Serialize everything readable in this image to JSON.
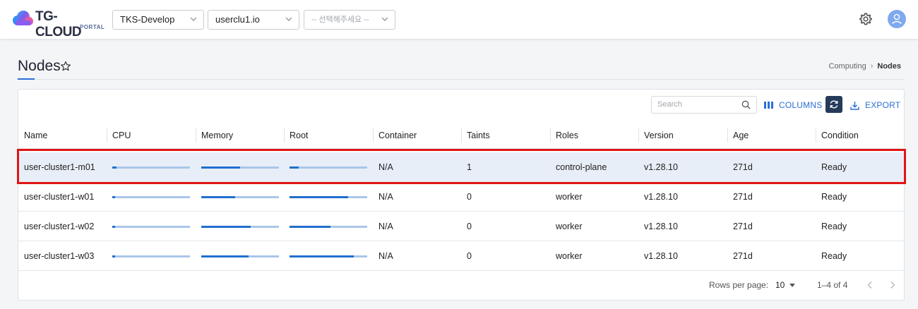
{
  "app": {
    "logo_text": "TG-CLOUD",
    "logo_subtext": "PORTAL"
  },
  "header": {
    "project_select": "TKS-Develop",
    "cluster_select": "userclu1.io",
    "namespace_placeholder": "-- 선택해주세요 --"
  },
  "page": {
    "title": "Nodes",
    "breadcrumb": [
      "Computing",
      "Nodes"
    ]
  },
  "toolbar": {
    "search_placeholder": "Search",
    "columns_label": "COLUMNS",
    "export_label": "EXPORT"
  },
  "table": {
    "columns": [
      "Name",
      "CPU",
      "Memory",
      "Root",
      "Container",
      "Taints",
      "Roles",
      "Version",
      "Age",
      "Condition"
    ],
    "rows": [
      {
        "name": "user-cluster1-m01",
        "cpu": 0.05,
        "memory": 0.5,
        "root": 0.12,
        "container": "N/A",
        "taints": "1",
        "roles": "control-plane",
        "version": "v1.28.10",
        "age": "271d",
        "condition": "Ready"
      },
      {
        "name": "user-cluster1-w01",
        "cpu": 0.04,
        "memory": 0.44,
        "root": 0.75,
        "container": "N/A",
        "taints": "0",
        "roles": "worker",
        "version": "v1.28.10",
        "age": "271d",
        "condition": "Ready"
      },
      {
        "name": "user-cluster1-w02",
        "cpu": 0.04,
        "memory": 0.64,
        "root": 0.53,
        "container": "N/A",
        "taints": "0",
        "roles": "worker",
        "version": "v1.28.10",
        "age": "271d",
        "condition": "Ready"
      },
      {
        "name": "user-cluster1-w03",
        "cpu": 0.04,
        "memory": 0.61,
        "root": 0.83,
        "container": "N/A",
        "taints": "0",
        "roles": "worker",
        "version": "v1.28.10",
        "age": "271d",
        "condition": "Ready"
      }
    ]
  },
  "pagination": {
    "rows_per_page_label": "Rows per page:",
    "rows_per_page_value": "10",
    "range_text": "1–4 of 4"
  },
  "colors": {
    "accent": "#2a6fd6",
    "bar_fill": "#1f6fce",
    "bar_track": "#a9c6e8",
    "selected_row": "#e8eef7",
    "highlight_outline": "#e01515"
  }
}
